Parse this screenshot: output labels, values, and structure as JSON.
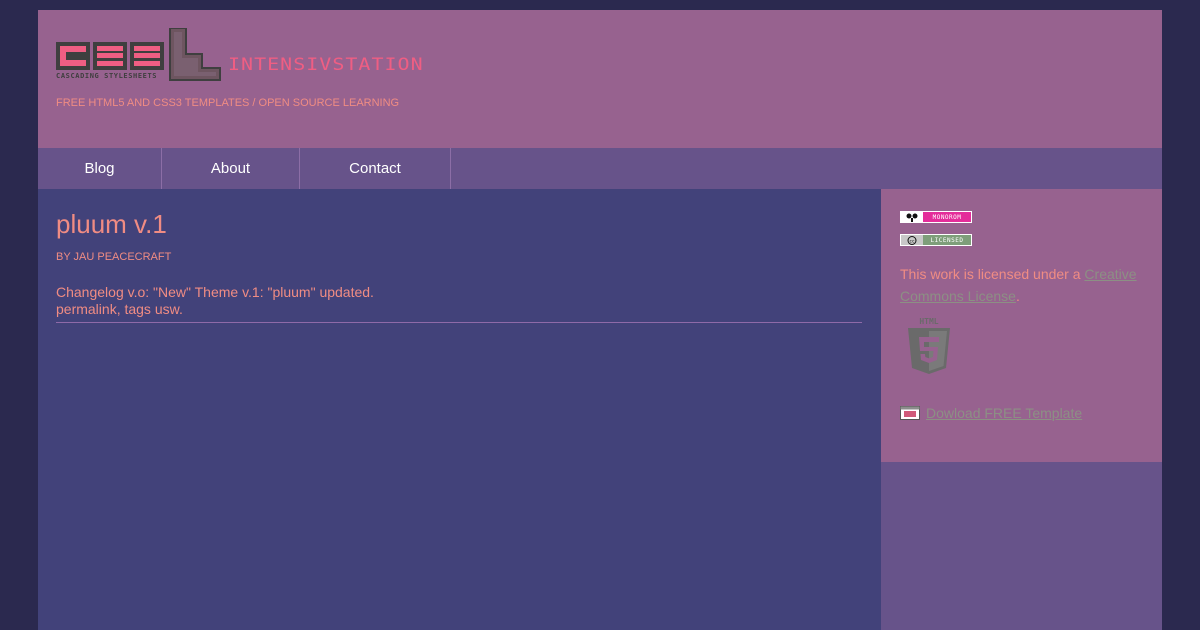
{
  "header": {
    "logo_caption": "Cascading Stylesheets",
    "site_title": "Intensivstation",
    "tagline": "Free HTML5 and CSS3 Templates / Open Source Learning"
  },
  "nav": {
    "items": [
      {
        "label": "Blog"
      },
      {
        "label": "About"
      },
      {
        "label": "Contact"
      }
    ]
  },
  "post": {
    "title": "pluum v.1",
    "byline": "by jau peacecraft",
    "line1": "Changelog v.o: \"New\" Theme v.1: \"pluum\" updated.",
    "line2": "permalink, tags usw."
  },
  "sidebar": {
    "badge_monorom": "Monorom",
    "badge_licensed": "Licensed",
    "license_prefix": "This work is licensed under a",
    "license_link": "Creative Commons License",
    "license_suffix": ".",
    "html5_label": "HTML",
    "download_link": "Dowload FREE Template"
  },
  "colors": {
    "page_bg": "#2b294f",
    "header_bg": "#97628f",
    "nav_bg": "#67538a",
    "main_bg": "#42427a",
    "accent_text": "#f08c83",
    "logo_pink": "#ef5e83",
    "link_gray": "#8c9084"
  }
}
